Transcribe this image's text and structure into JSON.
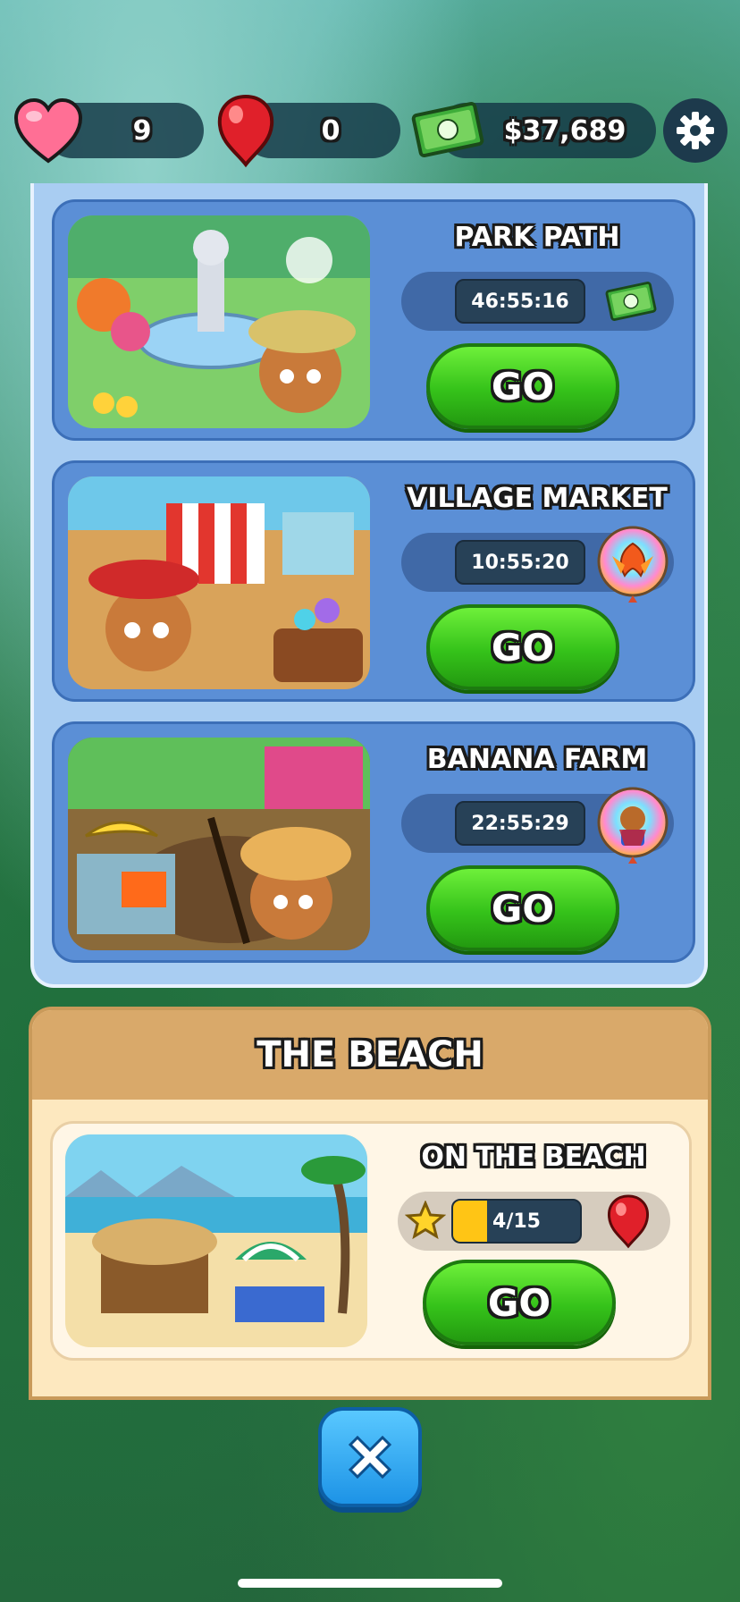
{
  "top_bar": {
    "lives": "9",
    "gems": "0",
    "cash": "$37,689"
  },
  "events": [
    {
      "title": "PARK PATH",
      "timer": "46:55:16",
      "reward_icon": "cash-icon",
      "go_label": "GO"
    },
    {
      "title": "VILLAGE MARKET",
      "timer": "10:55:20",
      "reward_icon": "phoenix-insta-icon",
      "go_label": "GO"
    },
    {
      "title": "BANANA FARM",
      "timer": "22:55:29",
      "reward_icon": "hero-insta-icon",
      "go_label": "GO"
    }
  ],
  "beach": {
    "section_title": "THE BEACH",
    "title": "ON THE BEACH",
    "progress": "4/15",
    "progress_fraction": 0.267,
    "reward_icon": "red-gem-icon",
    "go_label": "GO"
  },
  "colors": {
    "go_green": "#35c21a",
    "panel_blue": "#a9cdf2",
    "card_blue": "#5b8fd6",
    "beach_panel": "#fde8bf",
    "close_blue": "#1d93e6"
  }
}
